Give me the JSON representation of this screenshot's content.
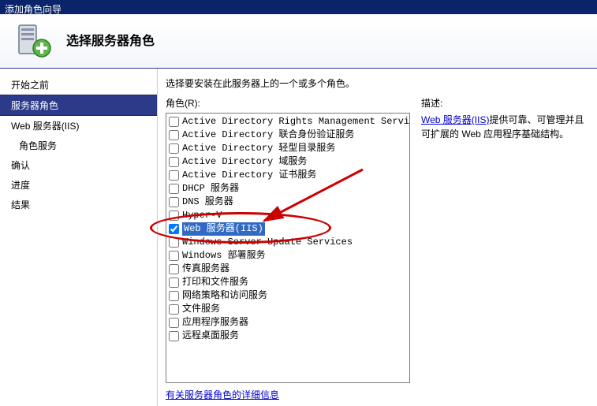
{
  "window": {
    "title": "添加角色向导"
  },
  "header": {
    "title": "选择服务器角色"
  },
  "sidebar": {
    "items": [
      {
        "label": "开始之前",
        "active": false,
        "indent": 0
      },
      {
        "label": "服务器角色",
        "active": true,
        "indent": 0
      },
      {
        "label": "Web 服务器(IIS)",
        "active": false,
        "indent": 0
      },
      {
        "label": "角色服务",
        "active": false,
        "indent": 1
      },
      {
        "label": "确认",
        "active": false,
        "indent": 0
      },
      {
        "label": "进度",
        "active": false,
        "indent": 0
      },
      {
        "label": "结果",
        "active": false,
        "indent": 0
      }
    ]
  },
  "main": {
    "instruction": "选择要安装在此服务器上的一个或多个角色。",
    "rolesLabel": "角色(R):",
    "roles": [
      {
        "label": "Active Directory Rights Management Services",
        "checked": false,
        "selected": false
      },
      {
        "label": "Active Directory 联合身份验证服务",
        "checked": false,
        "selected": false
      },
      {
        "label": "Active Directory 轻型目录服务",
        "checked": false,
        "selected": false
      },
      {
        "label": "Active Directory 域服务",
        "checked": false,
        "selected": false
      },
      {
        "label": "Active Directory 证书服务",
        "checked": false,
        "selected": false
      },
      {
        "label": "DHCP 服务器",
        "checked": false,
        "selected": false
      },
      {
        "label": "DNS 服务器",
        "checked": false,
        "selected": false
      },
      {
        "label": "Hyper-V",
        "checked": false,
        "selected": false
      },
      {
        "label": "Web 服务器(IIS)",
        "checked": true,
        "selected": true
      },
      {
        "label": "Windows Server Update Services",
        "checked": false,
        "selected": false
      },
      {
        "label": "Windows 部署服务",
        "checked": false,
        "selected": false
      },
      {
        "label": "传真服务器",
        "checked": false,
        "selected": false
      },
      {
        "label": "打印和文件服务",
        "checked": false,
        "selected": false
      },
      {
        "label": "网络策略和访问服务",
        "checked": false,
        "selected": false
      },
      {
        "label": "文件服务",
        "checked": false,
        "selected": false
      },
      {
        "label": "应用程序服务器",
        "checked": false,
        "selected": false
      },
      {
        "label": "远程桌面服务",
        "checked": false,
        "selected": false
      }
    ],
    "descTitle": "描述:",
    "descLink": "Web 服务器(IIS)",
    "descRest": "提供可靠、可管理并且可扩展的 Web 应用程序基础结构。",
    "moreInfo": "有关服务器角色的详细信息"
  }
}
